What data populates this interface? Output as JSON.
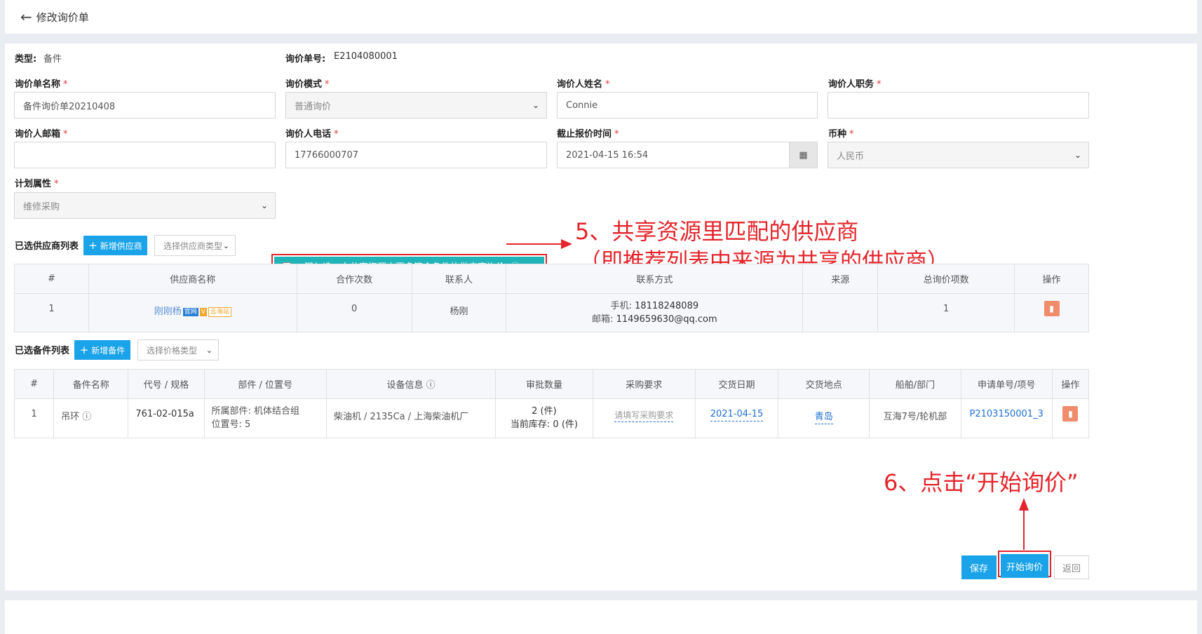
{
  "header": {
    "back_icon": "arrow-left-icon",
    "title": "修改询价单"
  },
  "info": {
    "type_label": "类型:",
    "type_value": "备件",
    "no_label": "询价单号:",
    "no_value": "E2104080001"
  },
  "fields": {
    "name": {
      "label": "询价单名称",
      "value": "备件询价单20210408"
    },
    "mode": {
      "label": "询价模式",
      "value": "普通询价"
    },
    "person": {
      "label": "询价人姓名",
      "value": "Connie"
    },
    "position": {
      "label": "询价人职务",
      "value": ""
    },
    "email": {
      "label": "询价人邮箱",
      "value": ""
    },
    "phone": {
      "label": "询价人电话",
      "value": "17766000707"
    },
    "deadline": {
      "label": "截止报价时间",
      "value": "2021-04-15 16:54"
    },
    "currency": {
      "label": "币种",
      "value": "人民币"
    },
    "plan": {
      "label": "计划属性",
      "value": "维修采购"
    },
    "required_mark": "*"
  },
  "supplier_section": {
    "title": "已选供应商列表",
    "add_button": "新增供应商",
    "type_select": "选择供应商类型",
    "share_checkbox": "一键勾选，向共享资源中更多符合条件的供应商询价",
    "info_icon": "ⓘ",
    "columns": [
      "#",
      "供应商名称",
      "合作次数",
      "联系人",
      "联系方式",
      "来源",
      "总询价项数",
      "操作"
    ],
    "rows": [
      {
        "idx": "1",
        "name": "刚刚杨",
        "tag1": "官网",
        "tag2": "V",
        "tag3": "云海站",
        "times": "0",
        "contact": "杨刚",
        "phone_label": "手机:",
        "phone": "18118248089",
        "email_label": "邮箱:",
        "email": "1149659630@qq.com",
        "source": "",
        "total": "1"
      }
    ]
  },
  "parts_section": {
    "title": "已选备件列表",
    "add_button": "新增备件",
    "type_select": "选择价格类型",
    "columns": [
      "#",
      "备件名称",
      "代号 / 规格",
      "部件 / 位置号",
      "设备信息",
      "审批数量",
      "采购要求",
      "交货日期",
      "交货地点",
      "船舶/部门",
      "申请单号/项号",
      "操作"
    ],
    "rows": [
      {
        "idx": "1",
        "name": "吊环",
        "code": "761-02-015a",
        "part_line1": "所属部件: 机体结合组",
        "part_line2": "位置号: 5",
        "device": "柴油机 / 2135Ca / 上海柴油机厂",
        "qty": "2 (件)",
        "stock": "当前库存: 0 (件)",
        "req_placeholder": "请填写采购要求",
        "date": "2021-04-15",
        "place": "青岛",
        "ship": "互海7号/轮机部",
        "apply": "P2103150001_3"
      }
    ]
  },
  "annotations": {
    "step5_line1": "5、共享资源里匹配的供应商",
    "step5_line2": "（即推荐列表中来源为共享的供应商）",
    "step6": "6、点击“开始询价”"
  },
  "footer": {
    "save": "保存",
    "start": "开始询价",
    "back": "返回"
  },
  "colors": {
    "primary": "#1aa3e8",
    "teal": "#20b4b8",
    "annotation": "#e4242b",
    "delete": "#f08c6c"
  }
}
